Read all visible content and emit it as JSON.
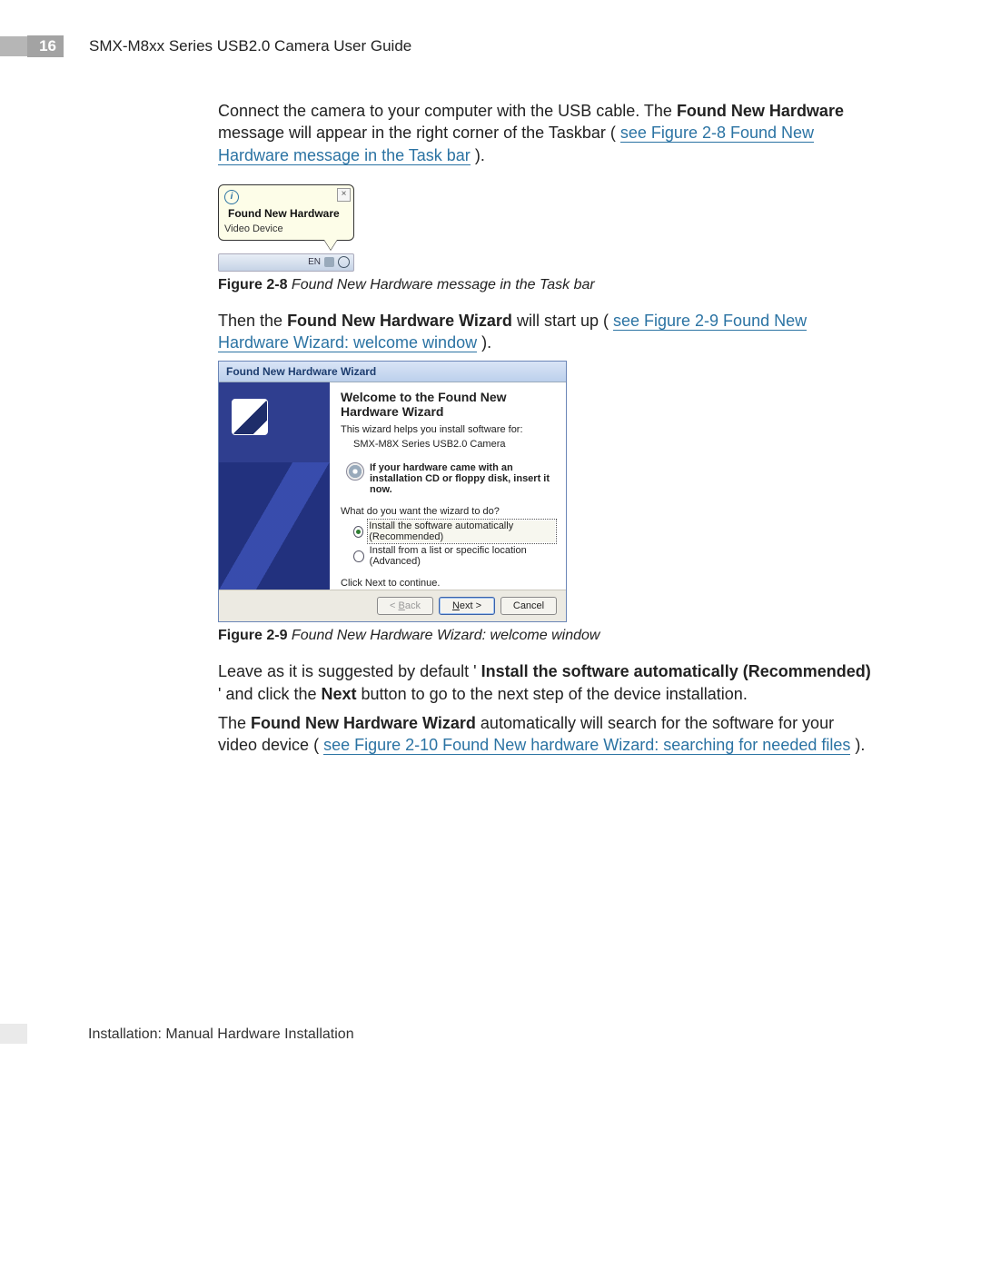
{
  "header": {
    "page_number": "16",
    "title": "SMX-M8xx Series USB2.0 Camera User Guide"
  },
  "p1": {
    "pre": "Connect the camera to your computer with the USB cable. The ",
    "bold": "Found New Hardware",
    "mid": " message will appear in the right corner of the Taskbar (",
    "link": "see Figure 2-8 Found New Hardware message in the Task bar",
    "post": ")."
  },
  "balloon": {
    "title": "Found New Hardware",
    "body": "Video Device",
    "close": "×"
  },
  "systray": {
    "lang": "EN"
  },
  "caption28": {
    "label": "Figure 2-8",
    "text": "Found New Hardware message in the Task bar"
  },
  "p2": {
    "pre": "Then the ",
    "bold": "Found New Hardware Wizard",
    "mid": " will start up (",
    "link": "see Figure 2-9 Found New Hardware Wizard: welcome window",
    "post": ")."
  },
  "wizard": {
    "title": "Found New Hardware Wizard",
    "heading": "Welcome to the Found New Hardware Wizard",
    "intro": "This wizard helps you install software for:",
    "device": "SMX-M8X Series USB2.0 Camera",
    "cd_note": "If your hardware came with an installation CD or floppy disk, insert it now.",
    "question": "What do you want the wizard to do?",
    "opt1": "Install the software automatically (Recommended)",
    "opt2": "Install from a list or specific location (Advanced)",
    "continue": "Click Next to continue.",
    "back_pre": "< ",
    "back_u": "B",
    "back_post": "ack",
    "next_u": "N",
    "next_post": "ext >",
    "cancel": "Cancel"
  },
  "caption29": {
    "label": "Figure 2-9",
    "text": "Found New Hardware Wizard: welcome window"
  },
  "p3": {
    "pre": "Leave as it is suggested by default '",
    "bold1": "Install the software automatically (Recommended)",
    "mid1": "' and click the ",
    "bold2": "Next",
    "post": " button to go to the next step of the device installation."
  },
  "p4": {
    "pre": "The ",
    "bold": "Found New Hardware Wizard",
    "mid": " automatically will search for the software for your video device (",
    "link": "see Figure 2-10 Found New hardware Wizard: searching for needed files",
    "post": ")."
  },
  "footer": "Installation:  Manual Hardware Installation"
}
